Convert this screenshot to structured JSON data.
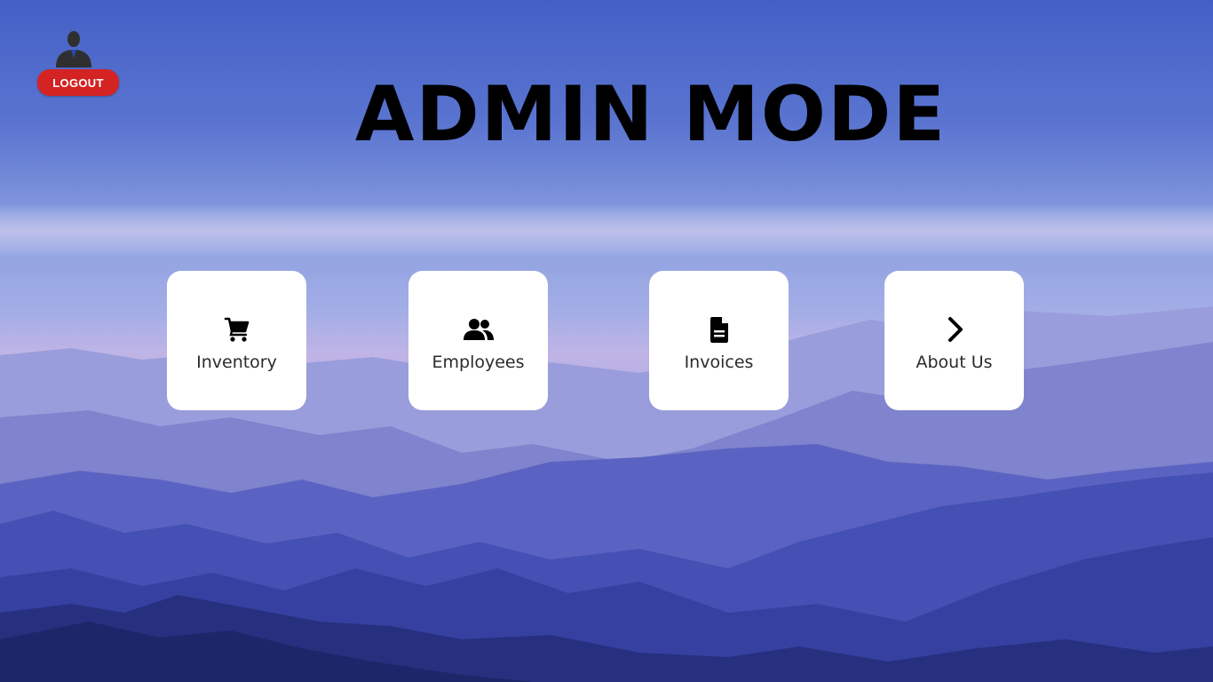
{
  "header": {
    "title": "ADMIN MODE",
    "logout_label": "LOGOUT",
    "avatar_icon": "user-silhouette-icon"
  },
  "menu": {
    "inventory": {
      "label": "Inventory",
      "icon": "shopping-cart-icon"
    },
    "employees": {
      "label": "Employees",
      "icon": "users-icon"
    },
    "invoices": {
      "label": "Invoices",
      "icon": "document-icon"
    },
    "about": {
      "label": "About Us",
      "icon": "chevron-right-icon"
    }
  },
  "colors": {
    "logout_button": "#d42323",
    "tile_background": "#ffffff",
    "sky_top": "#4a5fc4",
    "mountains_dark": "#1f2a78"
  }
}
